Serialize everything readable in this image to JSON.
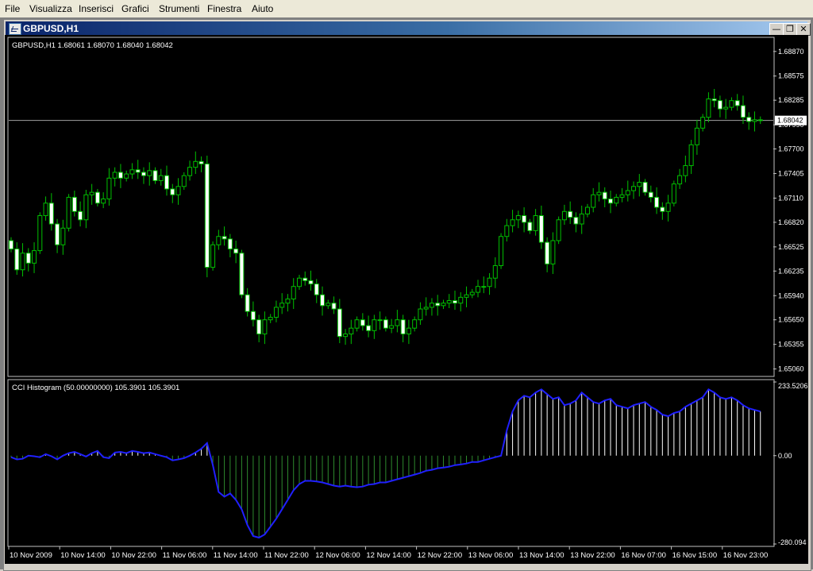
{
  "menu": {
    "items": [
      "File",
      "Visualizza",
      "Inserisci",
      "Grafici",
      "Strumenti",
      "Finestra",
      "Aiuto"
    ]
  },
  "window": {
    "title": "GBPUSD,H1"
  },
  "chart_data": [
    {
      "type": "candlestick",
      "title": "GBPUSD,H1  1.68061 1.68070 1.68040 1.68042",
      "symbol": "GBPUSD,H1",
      "ohlc_last": [
        "1.68061",
        "1.68070",
        "1.68040",
        "1.68042"
      ],
      "current_price": 1.68042,
      "current_price_label": "1.68042",
      "y_ticks": [
        "1.68870",
        "1.68575",
        "1.68285",
        "1.67990",
        "1.67700",
        "1.67405",
        "1.67110",
        "1.66820",
        "1.66525",
        "1.66235",
        "1.65940",
        "1.65650",
        "1.65355",
        "1.65060"
      ],
      "ylim": [
        1.6498,
        1.6903
      ],
      "candle_colors": {
        "up": "#000000",
        "down": "#ffffff",
        "wick": "#00c000",
        "outline": "#00c000"
      },
      "closes": [
        1.665,
        1.6625,
        1.6645,
        1.6633,
        1.6648,
        1.669,
        1.6705,
        1.668,
        1.6655,
        1.6675,
        1.6712,
        1.6695,
        1.6685,
        1.6715,
        1.6718,
        1.6705,
        1.671,
        1.6735,
        1.6742,
        1.6735,
        1.674,
        1.6745,
        1.6742,
        1.6738,
        1.6744,
        1.6732,
        1.6738,
        1.6722,
        1.6715,
        1.6725,
        1.6738,
        1.6748,
        1.6755,
        1.6752,
        1.6628,
        1.6655,
        1.6665,
        1.6662,
        1.665,
        1.6645,
        1.6595,
        1.6575,
        1.6565,
        1.6548,
        1.6565,
        1.6568,
        1.658,
        1.6585,
        1.659,
        1.6605,
        1.6615,
        1.6612,
        1.6608,
        1.6595,
        1.6582,
        1.6585,
        1.6578,
        1.6545,
        1.6548,
        1.6555,
        1.6565,
        1.6558,
        1.6552,
        1.6565,
        1.6565,
        1.6555,
        1.6558,
        1.6565,
        1.6548,
        1.6555,
        1.6565,
        1.6578,
        1.658,
        1.6585,
        1.6582,
        1.6585,
        1.6588,
        1.6585,
        1.6592,
        1.6595,
        1.6598,
        1.6605,
        1.6605,
        1.6615,
        1.663,
        1.6665,
        1.6678,
        1.6685,
        1.669,
        1.6682,
        1.6672,
        1.669,
        1.6658,
        1.6632,
        1.666,
        1.6685,
        1.6695,
        1.6688,
        1.668,
        1.6692,
        1.67,
        1.6715,
        1.6718,
        1.671,
        1.6705,
        1.6712,
        1.6715,
        1.672,
        1.6725,
        1.673,
        1.6718,
        1.6712,
        1.67,
        1.6695,
        1.6705,
        1.6728,
        1.6738,
        1.675,
        1.6775,
        1.6795,
        1.6808,
        1.683,
        1.6828,
        1.6818,
        1.682,
        1.6828,
        1.6822,
        1.6808,
        1.6803,
        1.6805,
        1.6804
      ],
      "x_ticks": [
        "10 Nov 2009",
        "10 Nov 14:00",
        "10 Nov 22:00",
        "11 Nov 06:00",
        "11 Nov 14:00",
        "11 Nov 22:00",
        "12 Nov 06:00",
        "12 Nov 14:00",
        "12 Nov 22:00",
        "13 Nov 06:00",
        "13 Nov 14:00",
        "13 Nov 22:00",
        "16 Nov 07:00",
        "16 Nov 15:00",
        "16 Nov 23:00"
      ]
    },
    {
      "type": "bar",
      "title": "CCI Histogram (50.00000000) 105.3901 105.3901",
      "y_ticks": [
        "233.5206",
        "0.00",
        "-280.094"
      ],
      "ylim": [
        -280.094,
        233.5206
      ],
      "series": [
        {
          "name": "CCI",
          "color": "#2020ff"
        }
      ],
      "histogram_colors": {
        "positive": "#ffffff",
        "negative": "#2e8b2e"
      },
      "values": [
        -5,
        -12,
        -10,
        0,
        -2,
        -5,
        5,
        -2,
        -12,
        0,
        8,
        12,
        5,
        -3,
        8,
        15,
        -5,
        -8,
        10,
        12,
        8,
        15,
        12,
        8,
        10,
        5,
        0,
        -5,
        -15,
        -12,
        -8,
        0,
        10,
        22,
        40,
        -30,
        -115,
        -130,
        -120,
        -140,
        -170,
        -220,
        -255,
        -260,
        -250,
        -225,
        -200,
        -170,
        -140,
        -110,
        -90,
        -80,
        -80,
        -82,
        -85,
        -90,
        -95,
        -98,
        -95,
        -98,
        -100,
        -98,
        -92,
        -90,
        -85,
        -85,
        -80,
        -75,
        -70,
        -65,
        -60,
        -55,
        -48,
        -45,
        -40,
        -38,
        -35,
        -30,
        -28,
        -25,
        -20,
        -20,
        -15,
        -10,
        -5,
        0,
        80,
        140,
        175,
        190,
        185,
        200,
        210,
        195,
        180,
        185,
        160,
        165,
        175,
        200,
        185,
        170,
        165,
        175,
        180,
        160,
        155,
        150,
        160,
        165,
        170,
        155,
        145,
        130,
        125,
        135,
        140,
        155,
        165,
        175,
        185,
        210,
        200,
        185,
        180,
        185,
        175,
        160,
        150,
        145,
        140
      ]
    }
  ]
}
